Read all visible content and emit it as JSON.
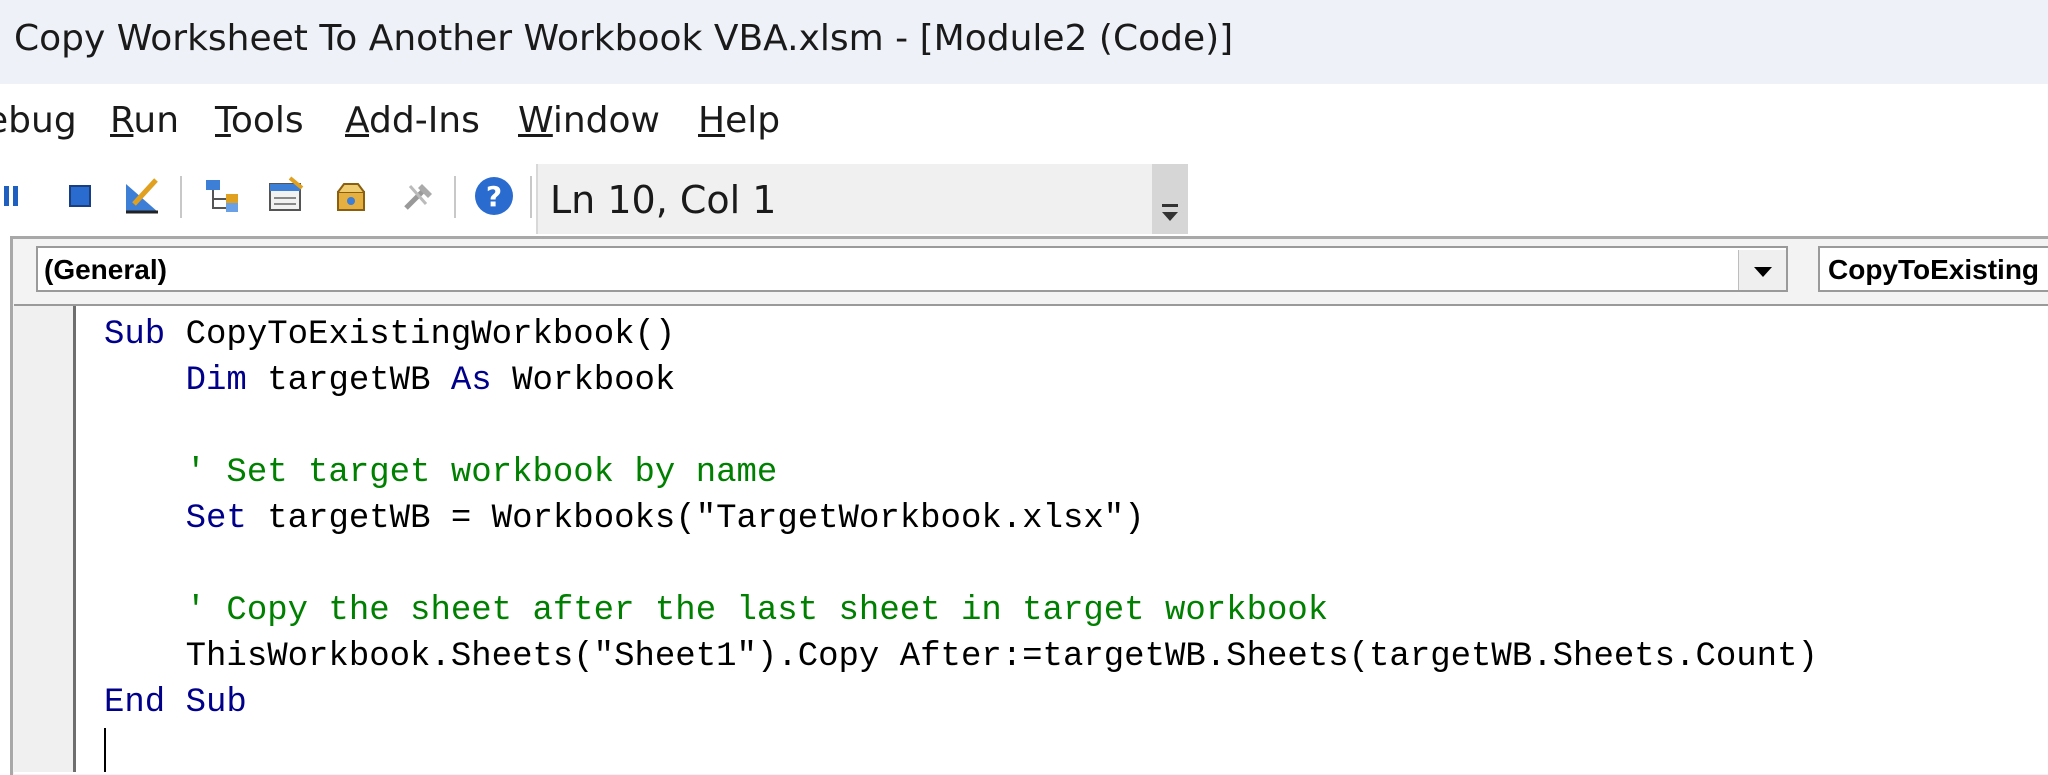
{
  "window": {
    "title": "Copy Worksheet To Another Workbook VBA.xlsm - [Module2 (Code)]"
  },
  "menu": {
    "items": [
      {
        "pre": "",
        "mn": "",
        "post": "ebug"
      },
      {
        "pre": "",
        "mn": "R",
        "post": "un"
      },
      {
        "pre": "",
        "mn": "T",
        "post": "ools"
      },
      {
        "pre": "",
        "mn": "A",
        "post": "dd-Ins"
      },
      {
        "pre": "",
        "mn": "W",
        "post": "indow"
      },
      {
        "pre": "",
        "mn": "H",
        "post": "elp"
      }
    ]
  },
  "toolbar": {
    "position": "Ln 10, Col 1",
    "icons": [
      "break-icon",
      "reset-icon",
      "design-mode-icon",
      "project-explorer-icon",
      "properties-window-icon",
      "object-browser-icon",
      "toolbox-icon",
      "help-icon"
    ]
  },
  "editor": {
    "object_combo": "(General)",
    "procedure_combo": "CopyToExisting",
    "lines": [
      [
        {
          "t": "Sub",
          "c": "kw"
        },
        {
          "t": " CopyToExistingWorkbook()",
          "c": ""
        }
      ],
      [
        {
          "t": "    ",
          "c": ""
        },
        {
          "t": "Dim",
          "c": "kw"
        },
        {
          "t": " targetWB ",
          "c": ""
        },
        {
          "t": "As",
          "c": "kw"
        },
        {
          "t": " Workbook",
          "c": ""
        }
      ],
      [],
      [
        {
          "t": "    ' Set target workbook by name",
          "c": "cm"
        }
      ],
      [
        {
          "t": "    ",
          "c": ""
        },
        {
          "t": "Set",
          "c": "kw"
        },
        {
          "t": " targetWB = Workbooks(\"TargetWorkbook.xlsx\")",
          "c": ""
        }
      ],
      [],
      [
        {
          "t": "    ' Copy the sheet after the last sheet in target workbook",
          "c": "cm"
        }
      ],
      [
        {
          "t": "    ThisWorkbook.Sheets(\"Sheet1\").Copy After:=targetWB.Sheets(targetWB.Sheets.Count)",
          "c": ""
        }
      ],
      [
        {
          "t": "End",
          "c": "kw"
        },
        {
          "t": " ",
          "c": ""
        },
        {
          "t": "Sub",
          "c": "kw"
        }
      ]
    ]
  }
}
